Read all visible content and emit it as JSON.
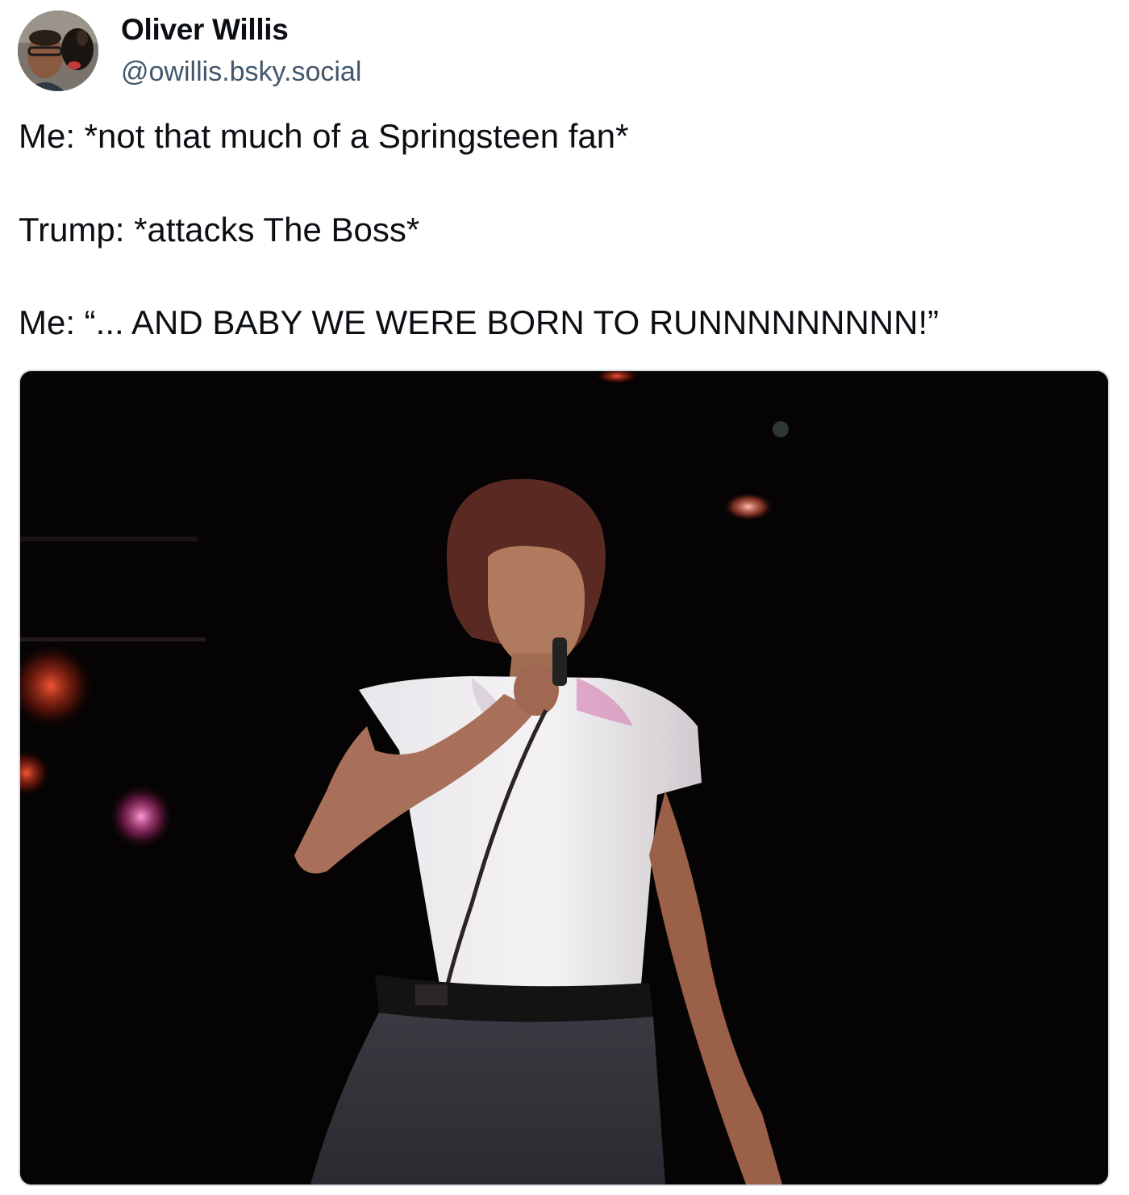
{
  "author": {
    "display_name": "Oliver Willis",
    "handle": "@owillis.bsky.social"
  },
  "post": {
    "lines": [
      "Me: *not that much of a Springsteen fan*",
      "Trump: *attacks The Boss*",
      "Me: “... AND BABY WE WERE BORN TO RUNNNNNNNNN!”"
    ]
  },
  "media": {
    "type": "gif",
    "subject": "performer in white t-shirt singing into microphone on dark stage"
  },
  "colors": {
    "text": "#0b0f14",
    "handle": "#42576c",
    "media_border": "#d6dde5",
    "stage_background": "#050303"
  }
}
